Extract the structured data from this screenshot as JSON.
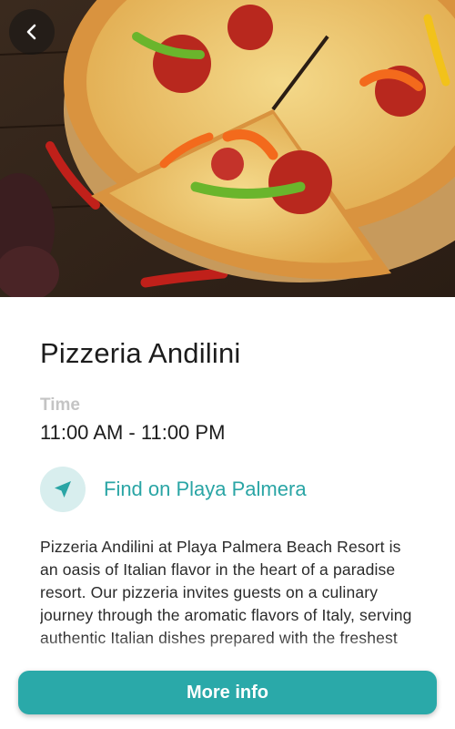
{
  "header": {
    "back_icon": "chevron-left-icon",
    "hero_image": "pizza-photo"
  },
  "restaurant": {
    "name": "Pizzeria Andilini",
    "time_label": "Time",
    "time_value": "11:00 AM - 11:00 PM",
    "locate_icon": "navigation-arrow-icon",
    "locate_label": "Find on Playa Palmera",
    "description": "Pizzeria Andilini at Playa Palmera Beach Resort is an oasis of Italian flavor in the heart of a paradise resort. Our pizzeria invites guests on a culinary journey through the aromatic flavors of Italy, serving authentic Italian dishes prepared with the freshest ingredients and the utmost care."
  },
  "footer": {
    "more_info_label": "More info"
  },
  "colors": {
    "accent": "#2aa9a9",
    "accent_light": "#d8eeee",
    "muted_label": "#c4c4c4"
  }
}
